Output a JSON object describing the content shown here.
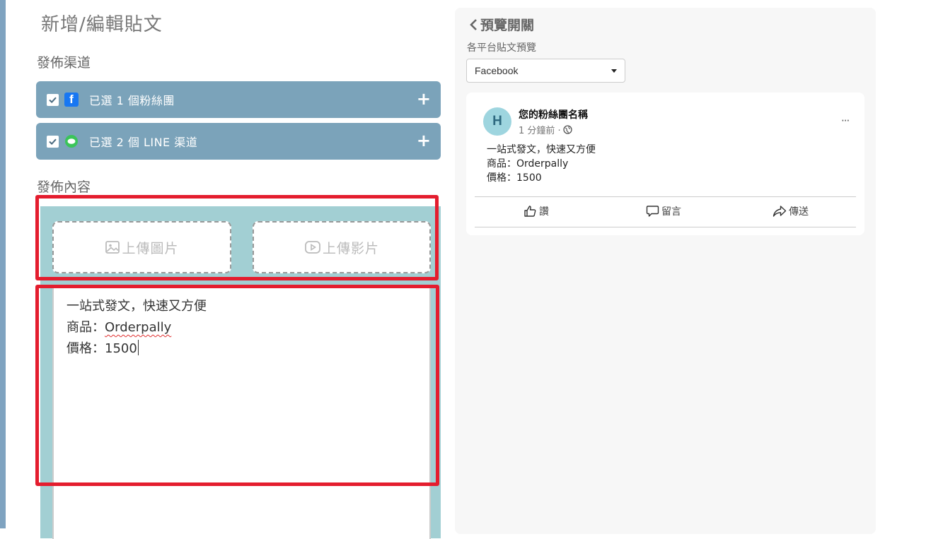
{
  "page": {
    "title": "新增/編輯貼文"
  },
  "channels": {
    "section_label": "發佈渠道",
    "facebook": {
      "label": "已選 1 個粉絲團",
      "checked": true,
      "icon": "facebook-icon",
      "add": "+"
    },
    "line": {
      "label": "已選 2 個 LINE 渠道",
      "checked": true,
      "icon": "line-icon",
      "add": "+"
    }
  },
  "content": {
    "section_label": "發佈內容",
    "upload_image_label": "上傳圖片",
    "upload_video_label": "上傳影片",
    "editor_lines": [
      "一站式發文，快速又方便",
      "商品：",
      "Orderpally",
      "價格：1500"
    ]
  },
  "preview": {
    "toggle_label": "預覽開關",
    "subtitle": "各平台貼文預覽",
    "platform_selected": "Facebook",
    "post": {
      "avatar_letter": "H",
      "page_name": "您的粉絲團名稱",
      "time": "1 分鐘前 ·",
      "more": "···",
      "lines": [
        "一站式發文，快速又方便",
        "商品：Orderpally",
        "價格：1500"
      ],
      "actions": {
        "like": "讚",
        "comment": "留言",
        "share": "傳送"
      }
    }
  },
  "colors": {
    "channel_bar": "#7ba3ba",
    "content_panel": "#a2cfd3",
    "highlight": "#e41d2e",
    "facebook_blue": "#1877f2",
    "line_green": "#3bc45a"
  }
}
